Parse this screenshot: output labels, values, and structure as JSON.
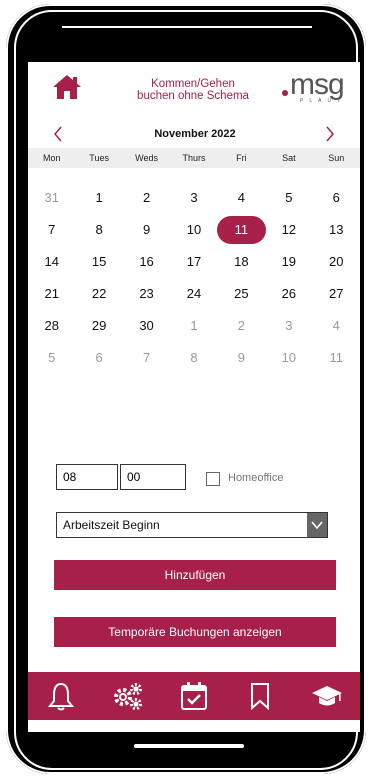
{
  "header": {
    "title_line1": "Kommen/Gehen",
    "title_line2": "buchen ohne Schema",
    "logo_text": "msg",
    "logo_subtext": "PLAUT"
  },
  "calendar": {
    "month": "November 2022",
    "weekdays": [
      "Mon",
      "Tues",
      "Weds",
      "Thurs",
      "Fri",
      "Sat",
      "Sun"
    ],
    "weeks": [
      [
        "31",
        "1",
        "2",
        "3",
        "4",
        "5",
        "6"
      ],
      [
        "7",
        "8",
        "9",
        "10",
        "11",
        "12",
        "13"
      ],
      [
        "14",
        "15",
        "16",
        "17",
        "18",
        "19",
        "20"
      ],
      [
        "21",
        "22",
        "23",
        "24",
        "25",
        "26",
        "27"
      ],
      [
        "28",
        "29",
        "30",
        "1",
        "2",
        "3",
        "4"
      ],
      [
        "5",
        "6",
        "7",
        "8",
        "9",
        "10",
        "11"
      ]
    ],
    "selected_day": "11"
  },
  "form": {
    "hour": "08",
    "minute": "00",
    "homeoffice_label": "Homeoffice",
    "homeoffice_checked": false,
    "booking_type": "Arbeitszeit Beginn",
    "add_button": "Hinzufügen",
    "temp_button": "Temporäre Buchungen anzeigen"
  },
  "bottom_nav": [
    "bell-icon",
    "settings-gears-icon",
    "calendar-check-icon",
    "bookmark-icon",
    "graduation-cap-icon"
  ],
  "colors": {
    "accent": "#a6204a",
    "muted_text": "#9a9a9a",
    "weekday_bg": "#eeeeee"
  }
}
